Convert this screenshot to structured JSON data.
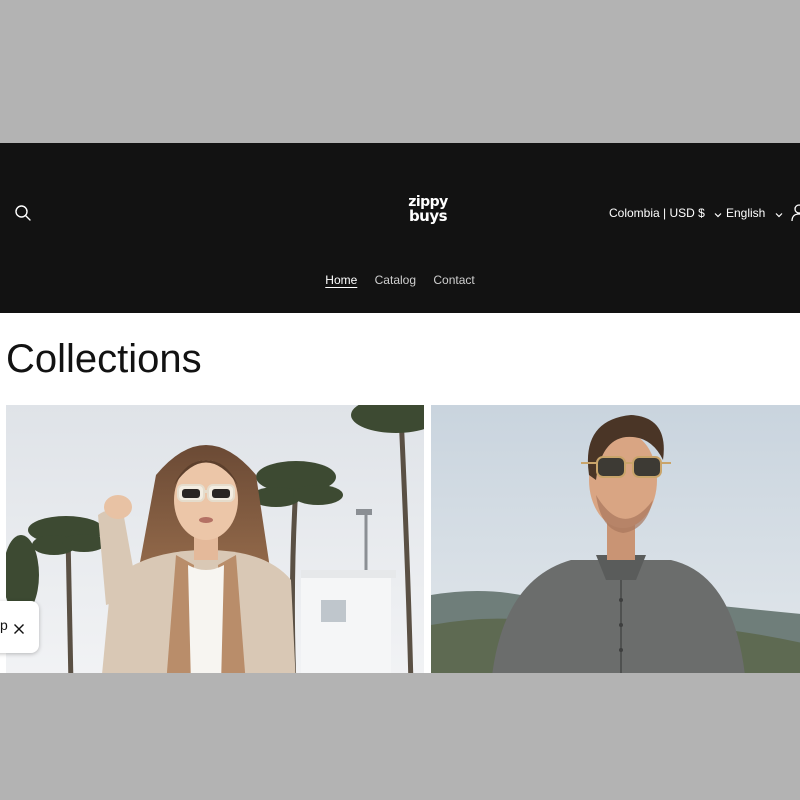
{
  "header": {
    "logo": {
      "line1": "zippy",
      "line2": "buys"
    },
    "search_icon": "search-icon",
    "country_selector": {
      "label": "Colombia | USD $",
      "icon": "chevron-down-icon"
    },
    "language_selector": {
      "label": "English",
      "icon": "chevron-down-icon"
    },
    "account_icon": "user-icon",
    "nav": [
      {
        "label": "Home",
        "active": true
      },
      {
        "label": "Catalog",
        "active": false
      },
      {
        "label": "Contact",
        "active": false
      }
    ]
  },
  "main": {
    "title": "Collections",
    "collections": [
      {
        "image": "woman-sunglasses-cardigan-palm-trees"
      },
      {
        "image": "man-sunglasses-linen-shirt-mountains"
      }
    ]
  },
  "popup": {
    "text": "p",
    "close_icon": "close-icon"
  },
  "colors": {
    "header_bg": "#121212",
    "page_bg": "#ffffff",
    "outer_bg": "#b3b3b3"
  }
}
